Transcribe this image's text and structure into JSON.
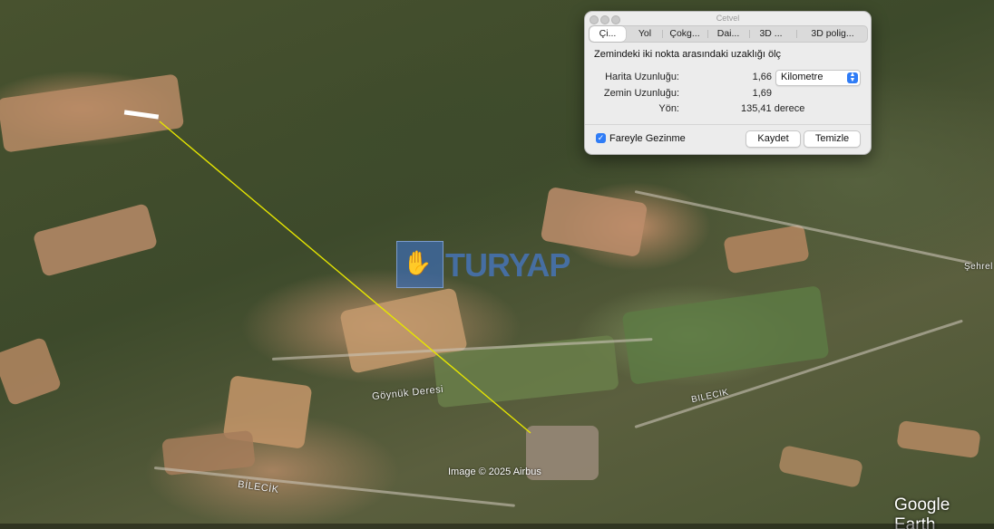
{
  "window": {
    "title": "Cetvel",
    "tabs": [
      "Çi...",
      "Yol",
      "Çokg...",
      "Dai...",
      "3D ...",
      "3D polig..."
    ],
    "active_tab": 0,
    "description": "Zemindeki iki nokta arasındaki uzaklığı ölç",
    "rows": [
      {
        "label": "Harita Uzunluğu:",
        "value": "1,66"
      },
      {
        "label": "Zemin Uzunluğu:",
        "value": "1,69"
      },
      {
        "label": "Yön:",
        "value": "135,41 derece"
      }
    ],
    "unit_select": {
      "value": "Kilometre",
      "icon": "chevron-updown-icon"
    },
    "checkbox": {
      "label": "Fareyle Gezinme",
      "checked": true
    },
    "save_button": "Kaydet",
    "clear_button": "Temizle"
  },
  "map": {
    "labels": {
      "creek": "Göynük Deresi",
      "road_1": "BILECIK",
      "road_2": "BİLECİK",
      "village": "Şehrel"
    },
    "watermark": "TURYAP",
    "credit": "Image © 2025 Airbus",
    "logo": "Google Earth",
    "measure_line_color": "#e6e600"
  }
}
